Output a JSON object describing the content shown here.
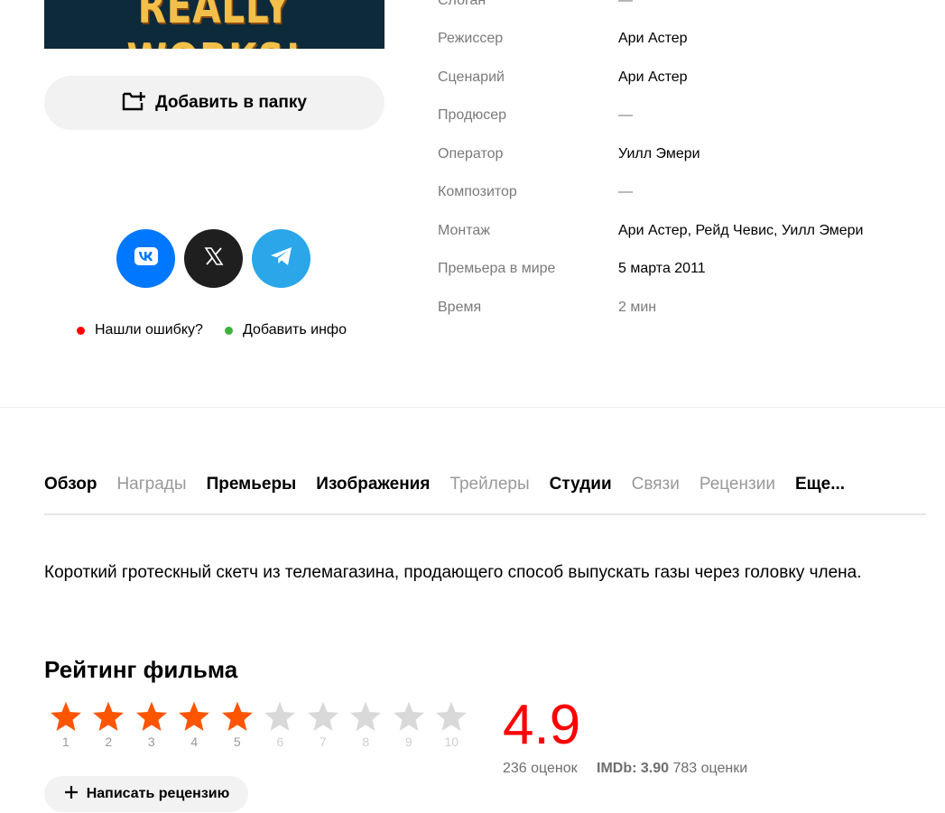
{
  "poster": {
    "text": "REALLY WORKS!"
  },
  "actions": {
    "add_to_folder": "Добавить в папку",
    "report_error": "Нашли ошибку?",
    "add_info": "Добавить инфо"
  },
  "colors": {
    "vk": "#0077ff",
    "x": "#1f1f1f",
    "telegram": "#2aa6e9",
    "error_dot": "#ff0000",
    "info_dot": "#3bb33b",
    "star_active": "#ff5500",
    "star_inactive": "#d9d9d9",
    "score": "#ff0000"
  },
  "icons": {
    "vk": "vk-icon",
    "x": "x-icon",
    "telegram": "telegram-icon",
    "folder": "folder-add-icon",
    "plus": "plus-icon"
  },
  "info": [
    {
      "label": "Слоган",
      "value": "—"
    },
    {
      "label": "Режиссер",
      "value": "Ари Астер"
    },
    {
      "label": "Сценарий",
      "value": "Ари Астер"
    },
    {
      "label": "Продюсер",
      "value": "—"
    },
    {
      "label": "Оператор",
      "value": "Уилл Эмери"
    },
    {
      "label": "Композитор",
      "value": "—"
    },
    {
      "label": "Монтаж",
      "value": "Ари Астер, Рейд Чевис, Уилл Эмери"
    },
    {
      "label": "Премьера в мире",
      "value": "5 марта 2011"
    },
    {
      "label": "Время",
      "value": "2 мин"
    }
  ],
  "tabs": [
    "Обзор",
    "Награды",
    "Премьеры",
    "Изображения",
    "Трейлеры",
    "Студии",
    "Связи",
    "Рецензии",
    "Еще..."
  ],
  "description": "Короткий гротескный скетч из телемагазина, продающего способ выпускать газы через головку члена.",
  "rating": {
    "title": "Рейтинг фильма",
    "stars": [
      "1",
      "2",
      "3",
      "4",
      "5",
      "6",
      "7",
      "8",
      "9",
      "10"
    ],
    "filled_stars": 5,
    "score": "4.9",
    "votes": "236 оценок",
    "imdb_label": "IMDb:",
    "imdb_score": "3.90",
    "imdb_votes": "783 оценки",
    "write_review": "Написать рецензию"
  }
}
